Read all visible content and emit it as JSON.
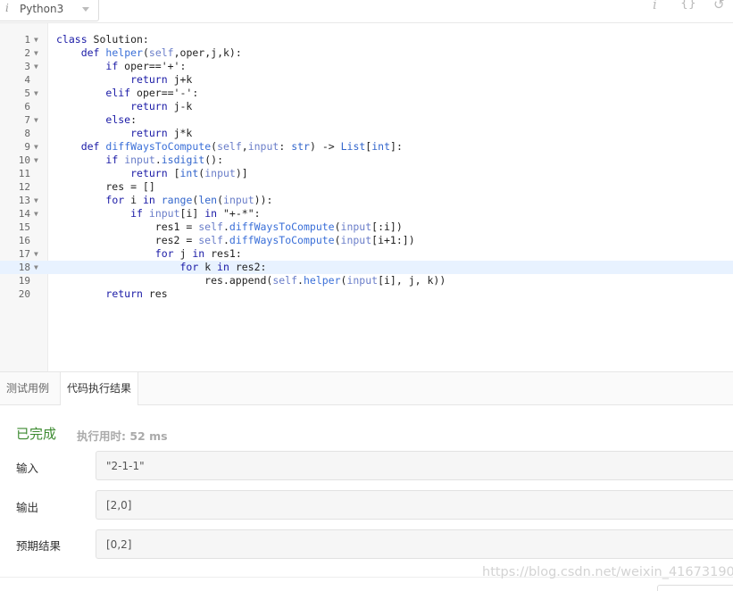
{
  "toolbar": {
    "language": "Python3",
    "info_icon_glyph": "i",
    "braces_icon_glyph": "{}",
    "reset_icon_glyph": "↺"
  },
  "editor": {
    "lines": [
      {
        "n": "1",
        "fold": true,
        "code": "class Solution:"
      },
      {
        "n": "2",
        "fold": true,
        "code": "    def helper(self,oper,j,k):"
      },
      {
        "n": "3",
        "fold": true,
        "code": "        if oper=='+':"
      },
      {
        "n": "4",
        "fold": false,
        "code": "            return j+k"
      },
      {
        "n": "5",
        "fold": true,
        "code": "        elif oper=='-':"
      },
      {
        "n": "6",
        "fold": false,
        "code": "            return j-k"
      },
      {
        "n": "7",
        "fold": true,
        "code": "        else:"
      },
      {
        "n": "8",
        "fold": false,
        "code": "            return j*k"
      },
      {
        "n": "9",
        "fold": true,
        "code": "    def diffWaysToCompute(self,input: str) -> List[int]:"
      },
      {
        "n": "10",
        "fold": true,
        "code": "        if input.isdigit():"
      },
      {
        "n": "11",
        "fold": false,
        "code": "            return [int(input)]"
      },
      {
        "n": "12",
        "fold": false,
        "code": "        res = []"
      },
      {
        "n": "13",
        "fold": true,
        "code": "        for i in range(len(input)):"
      },
      {
        "n": "14",
        "fold": true,
        "code": "            if input[i] in \"+-*\":"
      },
      {
        "n": "15",
        "fold": false,
        "code": "                res1 = self.diffWaysToCompute(input[:i])"
      },
      {
        "n": "16",
        "fold": false,
        "code": "                res2 = self.diffWaysToCompute(input[i+1:])"
      },
      {
        "n": "17",
        "fold": true,
        "code": "                for j in res1:"
      },
      {
        "n": "18",
        "fold": true,
        "code": "                    for k in res2:"
      },
      {
        "n": "19",
        "fold": false,
        "code": "                        res.append(self.helper(input[i], j, k))"
      },
      {
        "n": "20",
        "fold": false,
        "code": "        return res"
      }
    ],
    "active_line": 18
  },
  "tabs": [
    {
      "label": "测试用例",
      "active": false
    },
    {
      "label": "代码执行结果",
      "active": true
    }
  ],
  "result": {
    "status": "已完成",
    "time": "执行用时: 52 ms",
    "rows": [
      {
        "label": "输入",
        "value": "\"2-1-1\""
      },
      {
        "label": "输出",
        "value": "[2,0]"
      },
      {
        "label": "预期结果",
        "value": "[0,2]"
      }
    ]
  },
  "watermark": "https://blog.csdn.net/weixin_41673190",
  "colors": {
    "status_green": "#3c8a30",
    "active_line": "#e8f2ff"
  }
}
